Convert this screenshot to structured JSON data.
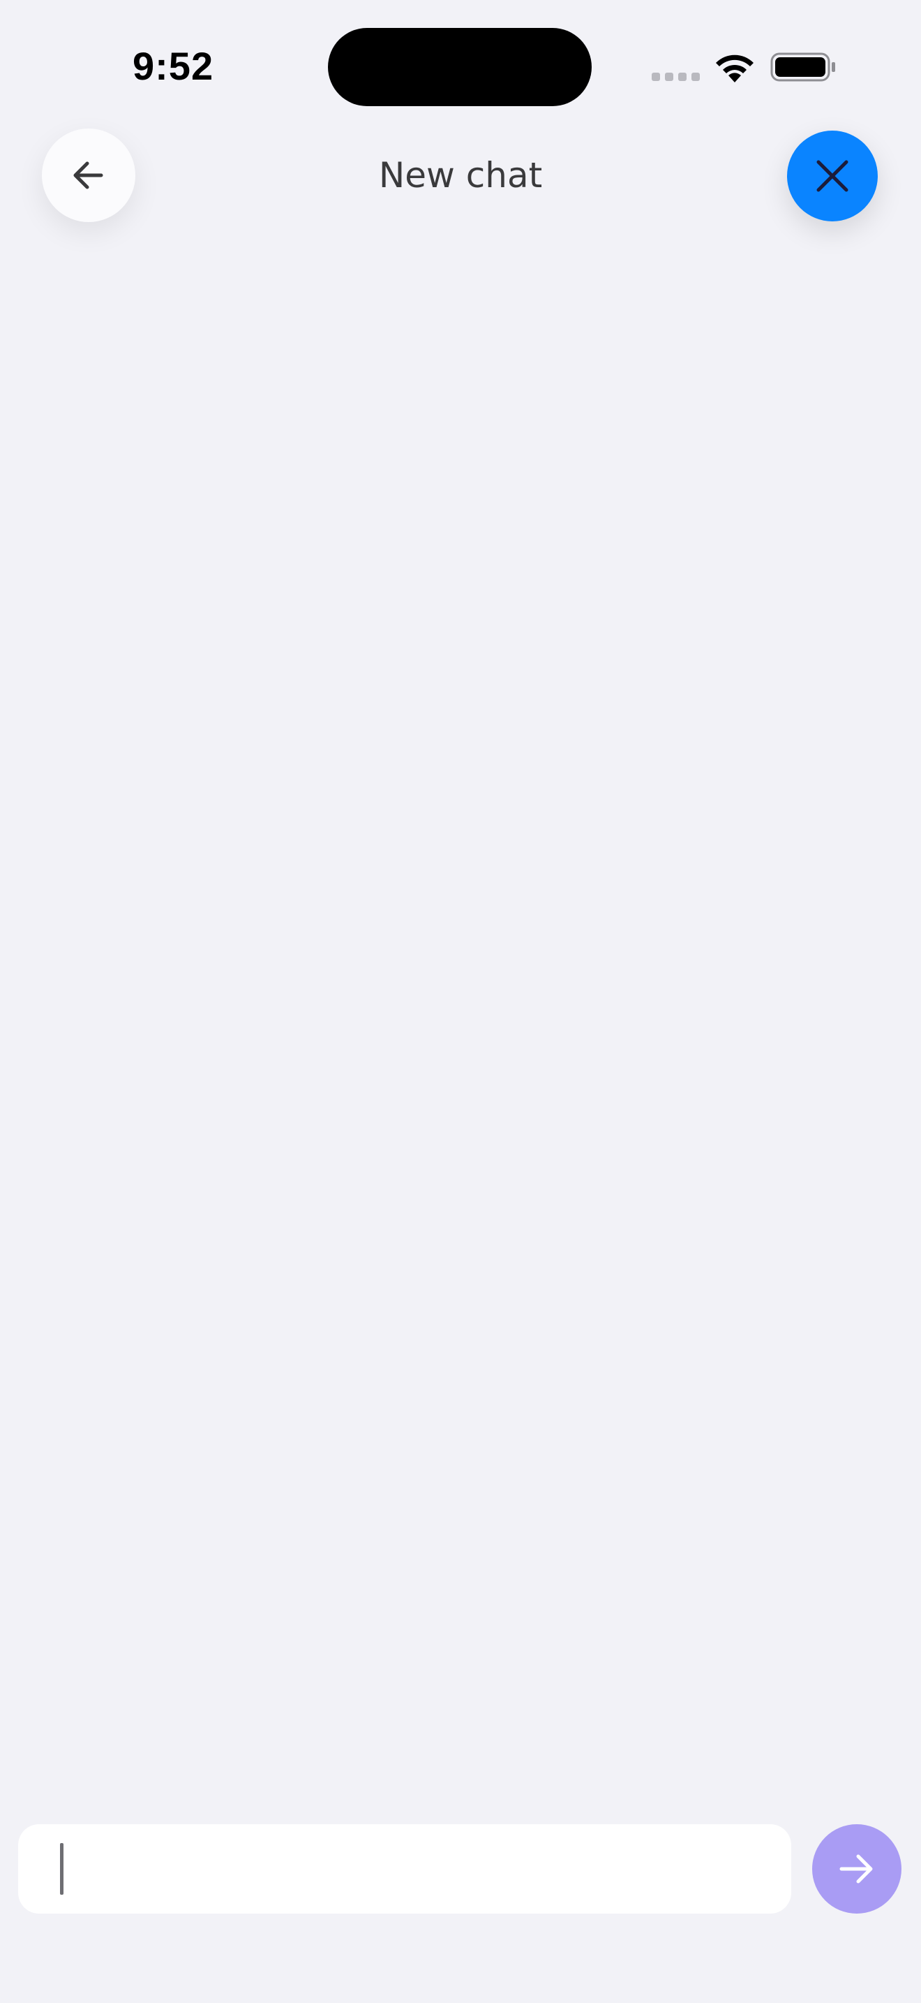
{
  "status_bar": {
    "time": "9:52"
  },
  "header": {
    "title": "New chat"
  },
  "icons": {
    "back": "arrow-left-icon",
    "close": "close-icon",
    "send": "arrow-right-icon",
    "wifi": "wifi-icon",
    "battery": "battery-icon",
    "signal": "signal-icon"
  },
  "colors": {
    "background": "#f2f2f7",
    "close_button": "#0a84ff",
    "send_button": "#a99cf4",
    "input_background": "#ffffff"
  },
  "composer": {
    "value": "",
    "placeholder": ""
  },
  "messages": []
}
